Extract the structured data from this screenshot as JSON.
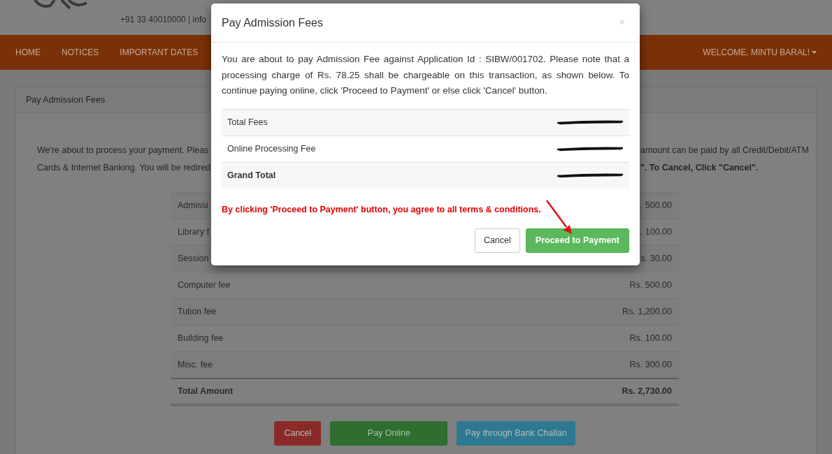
{
  "header": {
    "contact": "+91 33 40010000 | info"
  },
  "nav": {
    "items": [
      {
        "label": "HOME"
      },
      {
        "label": "NOTICES"
      },
      {
        "label": "IMPORTANT DATES"
      }
    ],
    "user_menu": "WELCOME, MINTU BARAL!"
  },
  "panel": {
    "title": "Pay Admission Fees",
    "intro_left": [
      "We're about to process your payment. Pleas",
      "Cards & Internet Banking. You will be redired"
    ],
    "intro_right": [
      {
        "text": "amount can be paid by all Credit/Debit/ATM",
        "bold": false
      },
      {
        "text": "\". To Cancel, Click \"Cancel\".",
        "bold": true
      }
    ]
  },
  "fees": {
    "rows": [
      {
        "label": "Admissi",
        "amount": ". 500.00"
      },
      {
        "label": "Library f",
        "amount": ". 100.00"
      },
      {
        "label": "Session",
        "amount": "s. 30.00"
      },
      {
        "label": "Computer fee",
        "amount": "Rs. 500.00"
      },
      {
        "label": "Tution fee",
        "amount": "Rs. 1,200.00"
      },
      {
        "label": "Building fee",
        "amount": "Rs. 100.00"
      },
      {
        "label": "Misc. fee",
        "amount": "Rs. 300.00"
      }
    ],
    "total": {
      "label": "Total Amount",
      "amount": "Rs. 2,730.00"
    }
  },
  "buttons": [
    {
      "label": "Cancel",
      "kind": "danger"
    },
    {
      "label": "Pay Online",
      "kind": "success"
    },
    {
      "label": "Pay through Bank Challan",
      "kind": "info"
    }
  ],
  "modal": {
    "title": "Pay Admission Fees",
    "close": "×",
    "message": "You are about to pay Admission Fee against Application Id : SIBW/001702. Please note that a processing charge of Rs. 78.25 shall be chargeable on this transaction, as shown below. To continue paying online, click 'Proceed to Payment' or else click 'Cancel' button.",
    "summary": [
      {
        "label": "Total Fees",
        "kind": "item"
      },
      {
        "label": "Online Processing Fee",
        "kind": "item"
      },
      {
        "label": "Grand Total",
        "kind": "total"
      }
    ],
    "notice": "By clicking 'Proceed to Payment' button, you agree to all terms & conditions.",
    "buttons": [
      {
        "label": "Cancel",
        "kind": "default"
      },
      {
        "label": "Proceed to Payment",
        "kind": "success"
      }
    ]
  }
}
